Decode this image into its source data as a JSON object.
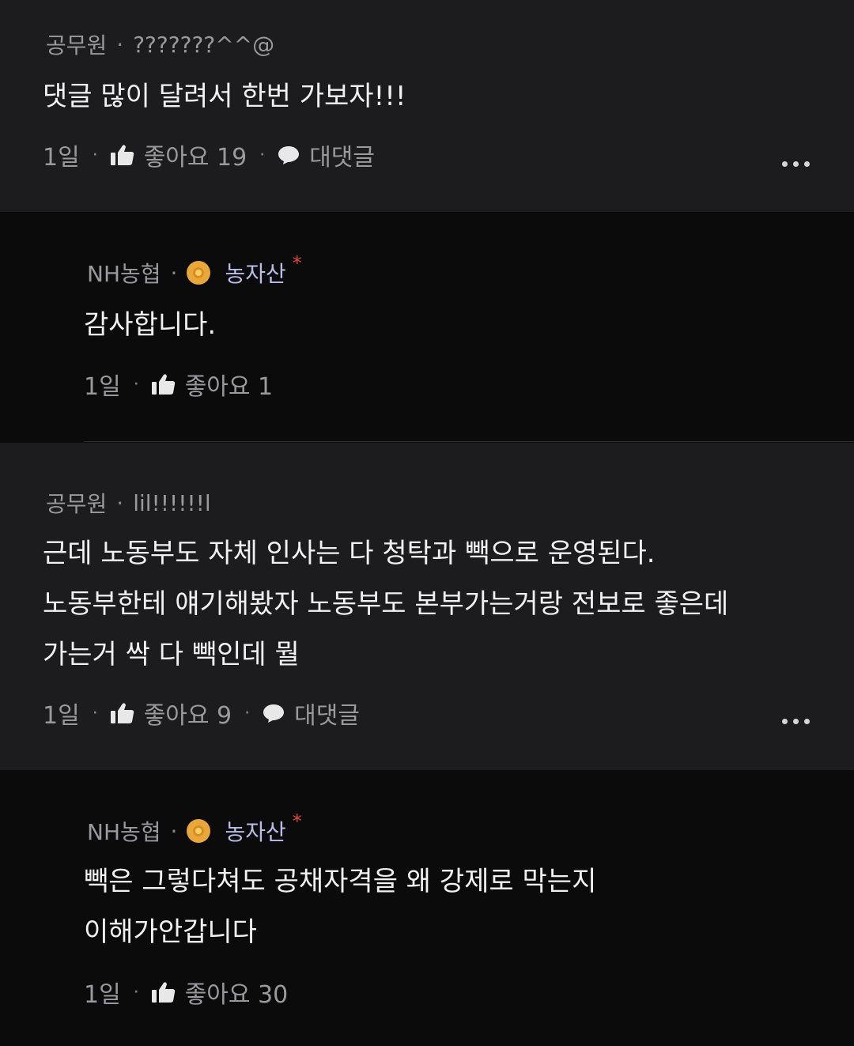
{
  "comments": [
    {
      "category": "공무원",
      "nickname": "???????^^@",
      "text_lines": [
        "댓글 많이 달려서 한번 가보자!!!"
      ],
      "time": "1일",
      "like_label": "좋아요 19",
      "reply_label": "대댓글"
    },
    {
      "category": "NH농협",
      "nickname": "농자산",
      "text_lines": [
        "감사합니다."
      ],
      "time": "1일",
      "like_label": "좋아요 1",
      "badge": "gold-badge-icon",
      "star": "*"
    },
    {
      "category": "공무원",
      "nickname": "lil!!!!!!l",
      "text_lines": [
        "근데 노동부도 자체 인사는 다 청탁과 빽으로 운영된다.",
        "노동부한테 얘기해봤자 노동부도 본부가는거랑 전보로 좋은데",
        "가는거 싹 다 빽인데 뭘"
      ],
      "time": "1일",
      "like_label": "좋아요 9",
      "reply_label": "대댓글"
    },
    {
      "category": "NH농협",
      "nickname": "농자산",
      "text_lines": [
        "빽은 그렇다쳐도 공채자격을 왜 강제로 막는지",
        "이해가안갑니다"
      ],
      "time": "1일",
      "like_label": "좋아요 30",
      "badge": "gold-badge-icon",
      "star": "*"
    }
  ],
  "separator_dot": "·",
  "colors": {
    "background": "#0b0b0c",
    "comment_bg": "#1c1c1e",
    "meta_text": "#9a9a9d",
    "nickname_blue": "#b9bde8",
    "star_red": "#e0463c",
    "badge_gold": "#e9a73a"
  }
}
